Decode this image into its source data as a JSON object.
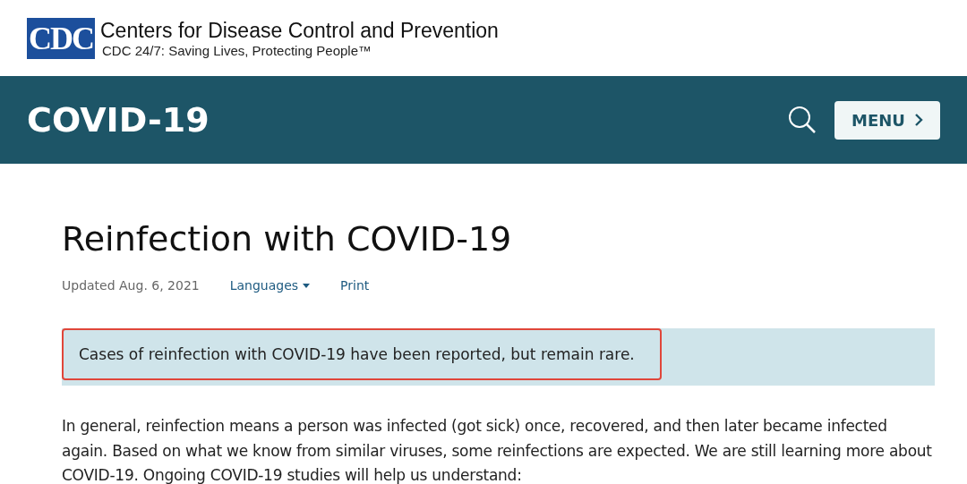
{
  "agency_header": {
    "logo_text": "CDC",
    "name": "Centers for Disease Control and Prevention",
    "tagline": "CDC 24/7: Saving Lives, Protecting People™"
  },
  "topic_bar": {
    "title": "COVID-19",
    "menu_button": "MENU"
  },
  "article": {
    "title": "Reinfection with COVID-19",
    "updated": "Updated Aug. 6, 2021",
    "links": [
      "Languages",
      "Print"
    ],
    "callout": {
      "text": "Cases of reinfection with COVID-19 have been reported, but remain rare.",
      "highlighted": true
    },
    "paragraph": "In general, reinfection means a person was infected (got sick) once, recovered, and then later became infected again. Based on what we know from similar viruses, some reinfections are expected. We are still learning more about COVID-19. Ongoing COVID-19 studies will help us understand:"
  }
}
